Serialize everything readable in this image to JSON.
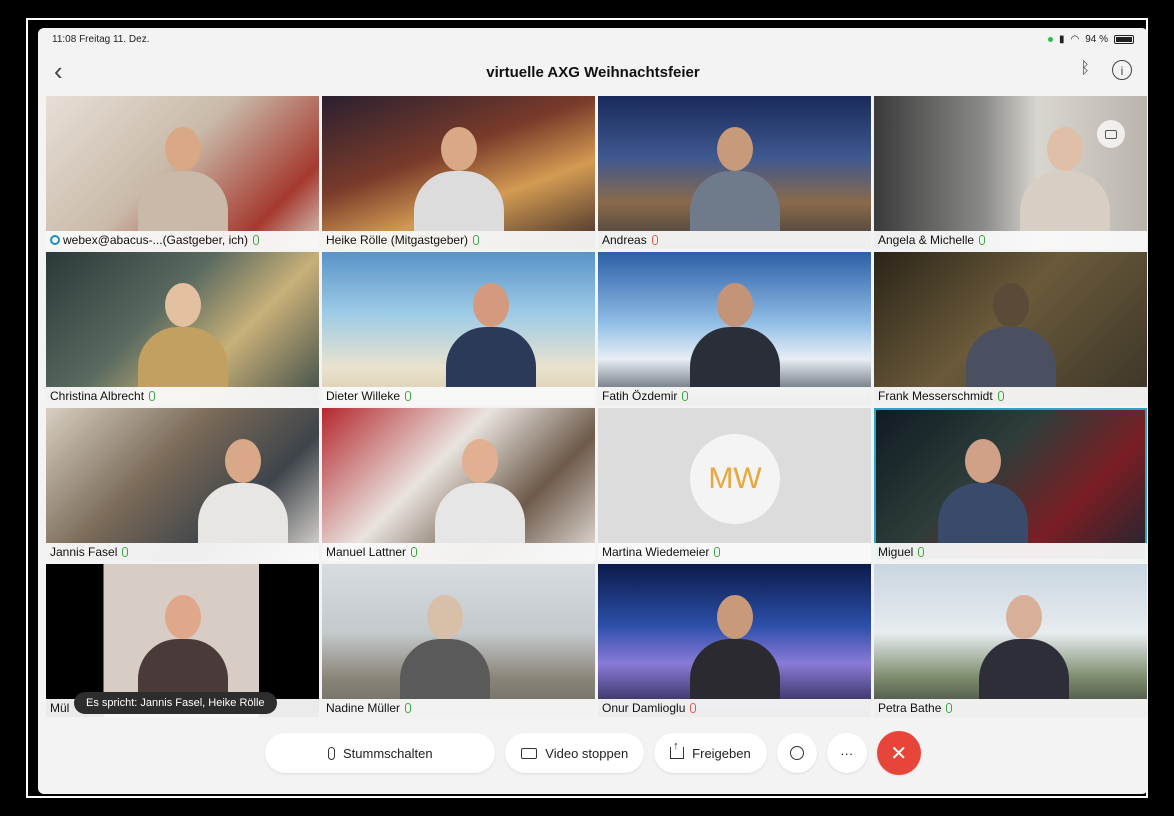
{
  "status": {
    "time": "11:08",
    "date": "Freitag 11. Dez.",
    "battery": "94 %"
  },
  "meeting": {
    "title": "virtuelle AXG Weihnachtsfeier"
  },
  "participants": [
    {
      "name": "webex@abacus-...(Gastgeber, ich)",
      "mic": "on"
    },
    {
      "name": "Heike Rölle (Mitgastgeber)",
      "mic": "on"
    },
    {
      "name": "Andreas",
      "mic": "off"
    },
    {
      "name": "Angela & Michelle",
      "mic": "on"
    },
    {
      "name": "Christina Albrecht",
      "mic": "on"
    },
    {
      "name": "Dieter Willeke",
      "mic": "on"
    },
    {
      "name": "Fatih Özdemir",
      "mic": "on"
    },
    {
      "name": "Frank Messerschmidt",
      "mic": "on"
    },
    {
      "name": "Jannis Fasel",
      "mic": "on"
    },
    {
      "name": "Manuel Lattner",
      "mic": "on"
    },
    {
      "name": "Martina Wiedemeier",
      "mic": "on",
      "initials": "MW"
    },
    {
      "name": "Miguel",
      "mic": "on"
    },
    {
      "name": "Mül",
      "mic": "on"
    },
    {
      "name": "Nadine Müller",
      "mic": "on"
    },
    {
      "name": "Onur Damlioglu",
      "mic": "off"
    },
    {
      "name": "Petra Bathe",
      "mic": "on"
    }
  ],
  "speaking_banner": "Es spricht: Jannis Fasel, Heike Rölle",
  "toolbar": {
    "mute_label": "Stummschalten",
    "video_label": "Video stoppen",
    "share_label": "Freigeben",
    "more_label": "···",
    "end_label": "✕"
  },
  "colors": {
    "accent_green": "#3aa640",
    "end_red": "#e8453a",
    "host_blue": "#1e8fc9"
  }
}
